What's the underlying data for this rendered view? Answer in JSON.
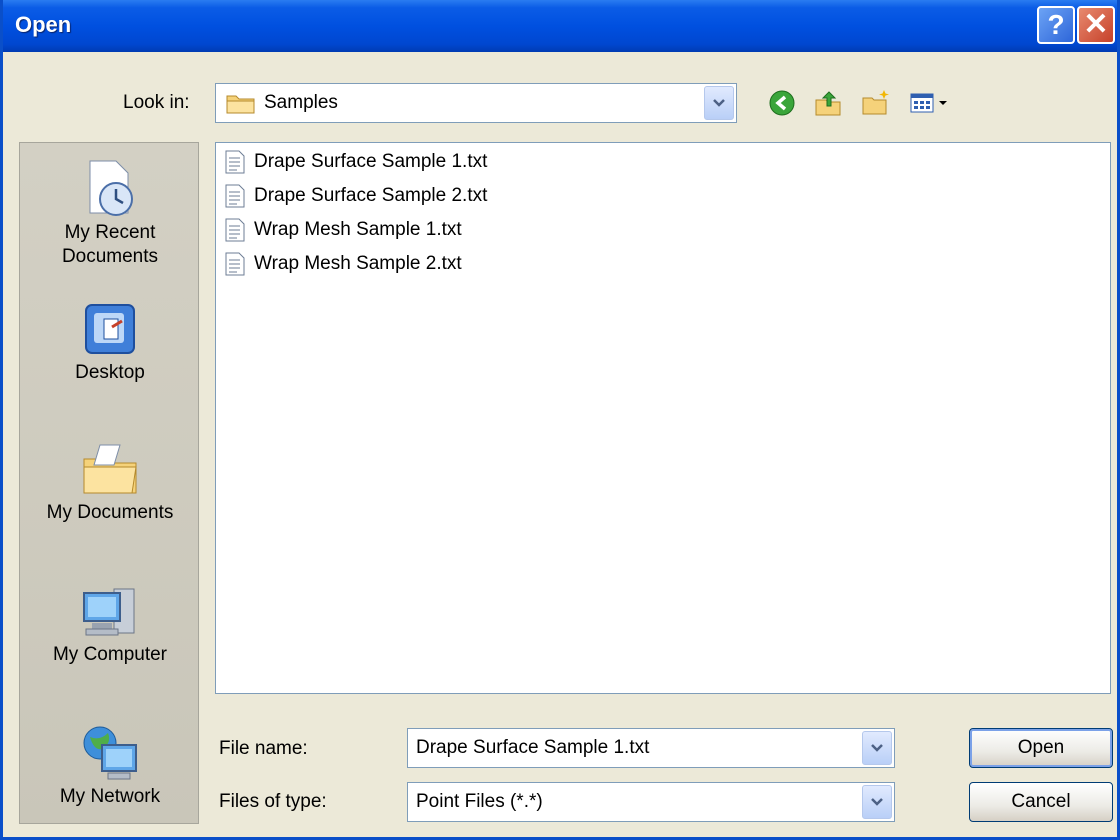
{
  "window": {
    "title": "Open"
  },
  "titlebar_buttons": {
    "help": "?",
    "close": "✕"
  },
  "lookin": {
    "label": "Look in:",
    "value": "Samples"
  },
  "toolbar": [
    {
      "name": "back-icon"
    },
    {
      "name": "up-folder-icon"
    },
    {
      "name": "new-folder-icon"
    },
    {
      "name": "view-menu-icon"
    }
  ],
  "places": [
    {
      "label_line1": "My Recent",
      "label_line2": "Documents",
      "icon": "recent-documents-icon"
    },
    {
      "label_line1": "Desktop",
      "label_line2": "",
      "icon": "desktop-icon"
    },
    {
      "label_line1": "My Documents",
      "label_line2": "",
      "icon": "my-documents-icon"
    },
    {
      "label_line1": "My Computer",
      "label_line2": "",
      "icon": "my-computer-icon"
    },
    {
      "label_line1": "My Network",
      "label_line2": "",
      "icon": "my-network-icon"
    }
  ],
  "files": [
    "Drape Surface Sample 1.txt",
    "Drape Surface Sample 2.txt",
    "Wrap Mesh Sample 1.txt",
    "Wrap Mesh Sample 2.txt"
  ],
  "filename": {
    "label": "File name:",
    "value": "Drape Surface Sample 1.txt"
  },
  "filetype": {
    "label": "Files of type:",
    "value": "Point Files (*.*)"
  },
  "buttons": {
    "open": "Open",
    "cancel": "Cancel"
  }
}
